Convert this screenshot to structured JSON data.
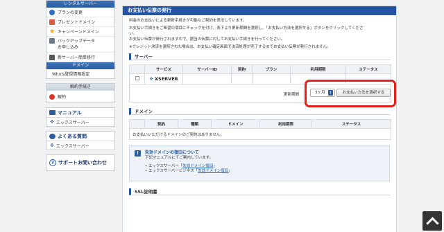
{
  "sidebar": {
    "rental_title": "レンタルサーバー",
    "rental_items": [
      {
        "label": "プランの変更",
        "icon": "globe-icon"
      },
      {
        "label": "プレゼントドメイン",
        "icon": "gift-icon"
      },
      {
        "label": "キャンペーンドメイン",
        "icon": "star-icon"
      },
      {
        "label": "バックアップデータ\nお申し込み",
        "icon": "disk-icon"
      },
      {
        "label": "新サーバー簡単移行",
        "icon": "server-icon"
      }
    ],
    "domain_title": "ドメイン",
    "domain_item": "Whois登録情報設定",
    "cancel_title": "解約手続き",
    "cancel_item": "解約",
    "manual_title": "マニュアル",
    "manual_item": "エックスサーバー",
    "faq_title": "よくある質問",
    "faq_item": "エックスサーバー",
    "support_label": "サポートお問い合わせ"
  },
  "main": {
    "title": "お支払い伝票の発行",
    "desc1": "料金のお支払いによる更新手続きが可能なご契約を表示しています。",
    "desc2a": "お支払い手続きをご希望の項目にチェックを付け、表下より更新期間を選択し、「お支払い方法を選択する」ボタンをクリックしてくださ",
    "desc2b": "い。",
    "desc2c": "お支払い伝票が発行されますので、据当の伝票に対してお支払い手続きを行ってください。",
    "desc3": "※クレジット決済を選択された場合は、お支払い確定画面で決済処理が完了するまでお支払い伝票が発行されません。",
    "server_section": "サーバー",
    "server_headers": [
      "サービス",
      "サーバーID",
      "契約",
      "プラン",
      "利用期限",
      "ステータス"
    ],
    "server_row": {
      "service": "XSERVER",
      "service_prefix": "✜"
    },
    "period_label": "更新期間",
    "period_value": "3ヶ月",
    "pay_button": "お支払い方法を選択する",
    "domain_section": "ドメイン",
    "domain_headers": [
      "契約",
      "種類",
      "ドメイン",
      "利用期限",
      "ステータス"
    ],
    "domain_empty": "お支払いいただけるドメインのご契約はありません。",
    "info_title": "失効ドメインの復旧について",
    "info_sub": "下記マニュアルにてご案内しています。",
    "info_link1_prefix": "エックスサーバー「",
    "info_link1": "失効ドメイン復旧",
    "info_link1_suffix": "」",
    "info_link2_prefix": "エックスサーバービジネス「",
    "info_link2": "失効ドメイン復旧",
    "info_link2_suffix": "」",
    "ssl_section": "SSL証明書"
  },
  "colors": {
    "accent": "#2455a4",
    "highlight": "#e0211c"
  }
}
